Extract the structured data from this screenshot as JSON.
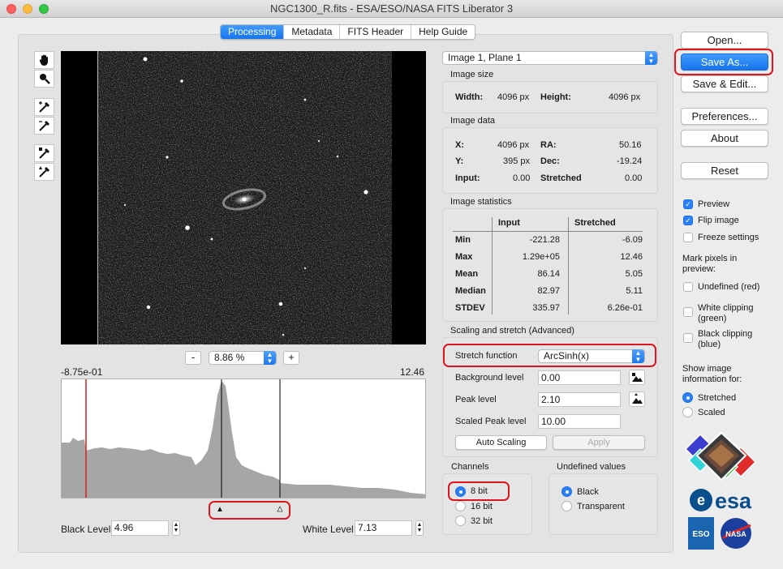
{
  "window": {
    "title": "NGC1300_R.fits - ESA/ESO/NASA FITS Liberator 3"
  },
  "tabs": [
    {
      "label": "Processing",
      "active": true
    },
    {
      "label": "Metadata",
      "active": false
    },
    {
      "label": "FITS Header",
      "active": false
    },
    {
      "label": "Help Guide",
      "active": false
    }
  ],
  "tools": [
    "hand-icon",
    "zoom-icon",
    "eyedropper-black-icon",
    "eyedropper-white-icon",
    "eyedropper-background-icon",
    "eyedropper-peak-icon"
  ],
  "zoom": {
    "minus": "-",
    "value": "8.86 %",
    "plus": "+"
  },
  "histogram": {
    "min_label": "-8.75e-01",
    "max_label": "12.46"
  },
  "levels": {
    "black_label": "Black Level",
    "black_value": "4.96",
    "white_label": "White Level",
    "white_value": "7.13"
  },
  "image_select": "Image 1, Plane 1",
  "image_size": {
    "header": "Image size",
    "width_label": "Width:",
    "width_value": "4096 px",
    "height_label": "Height:",
    "height_value": "4096 px"
  },
  "image_data": {
    "header": "Image data",
    "x_label": "X:",
    "x_value": "4096 px",
    "ra_label": "RA:",
    "ra_value": "50.16",
    "y_label": "Y:",
    "y_value": "395 px",
    "dec_label": "Dec:",
    "dec_value": "-19.24",
    "input_label": "Input:",
    "input_value": "0.00",
    "stretched_label": "Stretched",
    "stretched_value": "0.00"
  },
  "image_statistics": {
    "header": "Image statistics",
    "col_input": "Input",
    "col_stretched": "Stretched",
    "rows": [
      {
        "label": "Min",
        "input": "-221.28",
        "stretched": "-6.09"
      },
      {
        "label": "Max",
        "input": "1.29e+05",
        "stretched": "12.46"
      },
      {
        "label": "Mean",
        "input": "86.14",
        "stretched": "5.05"
      },
      {
        "label": "Median",
        "input": "82.97",
        "stretched": "5.11"
      },
      {
        "label": "STDEV",
        "input": "335.97",
        "stretched": "6.26e-01"
      }
    ]
  },
  "scaling": {
    "header": "Scaling and stretch (Advanced)",
    "stretch_label": "Stretch function",
    "stretch_value": "ArcSinh(x)",
    "background_label": "Background level",
    "background_value": "0.00",
    "peak_label": "Peak level",
    "peak_value": "2.10",
    "scaled_peak_label": "Scaled Peak level",
    "scaled_peak_value": "10.00",
    "auto_scaling": "Auto Scaling",
    "apply": "Apply"
  },
  "channels": {
    "header": "Channels",
    "options": [
      "8 bit",
      "16 bit",
      "32 bit"
    ],
    "selected": "8 bit"
  },
  "undefined_values": {
    "header": "Undefined values",
    "options": [
      "Black",
      "Transparent"
    ],
    "selected": "Black"
  },
  "buttons": {
    "open": "Open...",
    "save_as": "Save As...",
    "save_edit": "Save & Edit...",
    "preferences": "Preferences...",
    "about": "About",
    "reset": "Reset"
  },
  "options": {
    "preview": "Preview",
    "flip_image": "Flip image",
    "freeze": "Freeze settings",
    "mark_pixels_line1": "Mark pixels in",
    "mark_pixels_line2": "preview:",
    "undefined_red": "Undefined (red)",
    "white_clip_1": "White clipping",
    "white_clip_2": "(green)",
    "black_clip_1": "Black clipping",
    "black_clip_2": "(blue)",
    "show_info_1": "Show image",
    "show_info_2": "information for:",
    "info_options": [
      "Stretched",
      "Scaled"
    ],
    "info_selected": "Stretched"
  },
  "logos": {
    "esa": "esa",
    "eso": "ESO",
    "nasa": "NASA"
  },
  "colors": {
    "accent": "#1a76ee",
    "highlight": "#e0141e"
  }
}
